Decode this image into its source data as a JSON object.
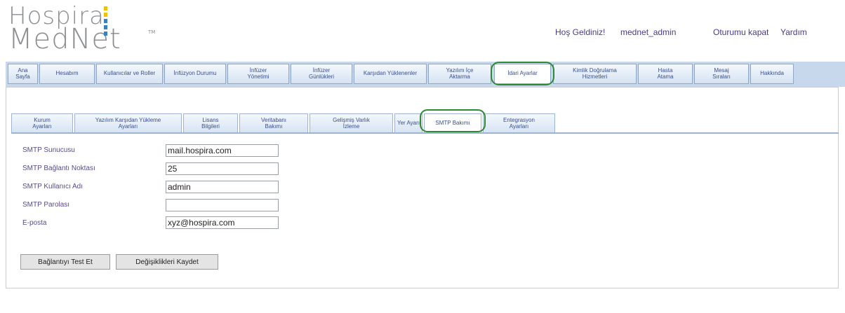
{
  "logo": {
    "line1": "Hospira",
    "line2": "MedNet",
    "tm": "TM"
  },
  "header": {
    "welcome": "Hoş Geldiniz!",
    "user": "mednet_admin",
    "logout": "Oturumu kapat",
    "help": "Yardım"
  },
  "main_tabs": [
    "Ana\nSayfa",
    "Hesabım",
    "Kullanıcılar ve Roller",
    "İnfüzyon Durumu",
    "İnfüzer\nYönetimi",
    "İnfüzer\nGünlükleri",
    "Karşıdan Yüklenenler",
    "Yazılım İçe\nAktarma",
    "İdari Ayarlar",
    "Kimlik Doğrulama\nHizmetleri",
    "Hasta\nAtama",
    "Mesaj\nSıraları",
    "Hakkında"
  ],
  "sub_tabs": [
    "Kurum\nAyarları",
    "Yazılım Karşıdan Yükleme\nAyarları",
    "Lisans\nBilgileri",
    "Veritabanı\nBakımı",
    "Gelişmiş Varlık\nİzleme",
    "Yer Ayarı",
    "SMTP Bakımı",
    "Entegrasyon\nAyarları"
  ],
  "form": {
    "smtp_server_label": "SMTP Sunucusu",
    "smtp_server_value": "mail.hospira.com",
    "smtp_port_label": "SMTP Bağlantı Noktası",
    "smtp_port_value": "25",
    "smtp_user_label": "SMTP Kullanıcı Adı",
    "smtp_user_value": "admin",
    "smtp_password_label": "SMTP Parolası",
    "smtp_password_value": "",
    "email_label": "E-posta",
    "email_value": "xyz@hospira.com"
  },
  "buttons": {
    "test_connection": "Bağlantıyı Test Et",
    "save_changes": "Değişiklikleri Kaydet"
  },
  "colors": {
    "tab_bar": "#c7d8ec",
    "highlight_ring": "#2e8a32",
    "label_text": "#5a4a8c"
  }
}
